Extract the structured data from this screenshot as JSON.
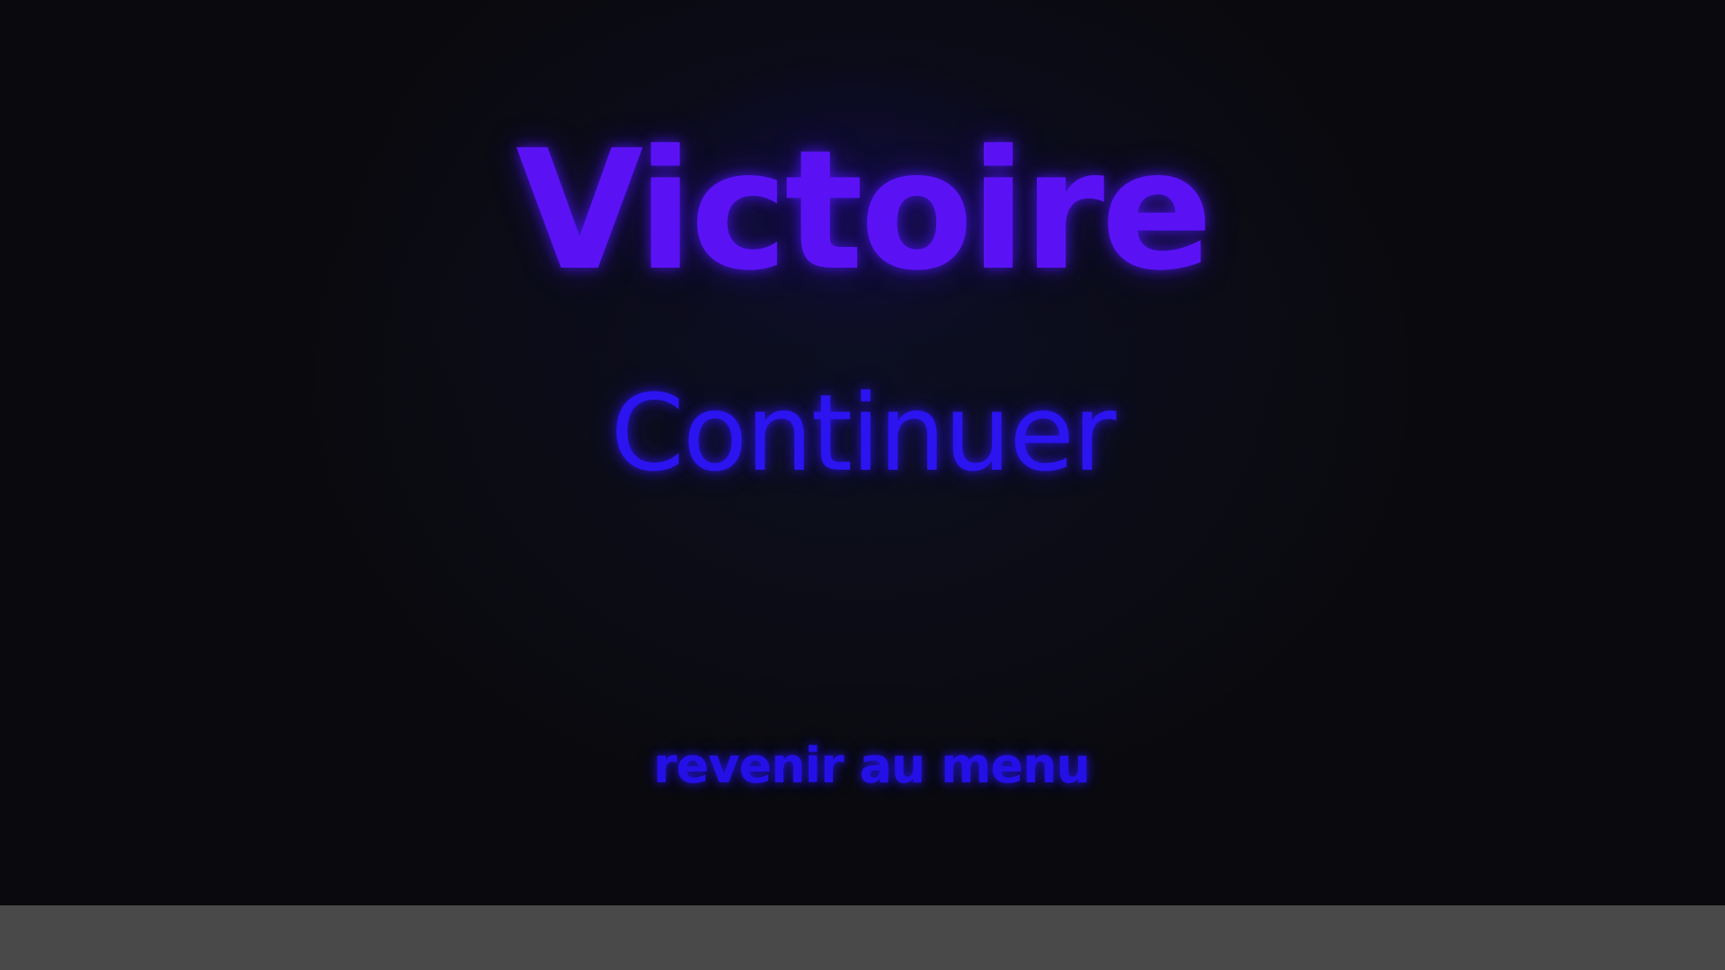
{
  "screen": {
    "title": "Victoire",
    "continue_label": "Continuer",
    "menu_label": "revenir au menu"
  },
  "colors": {
    "title": "#5a12f5",
    "buttons": "#2b14f0",
    "background": "#0a0a0c",
    "bottom_bar": "#494949"
  }
}
